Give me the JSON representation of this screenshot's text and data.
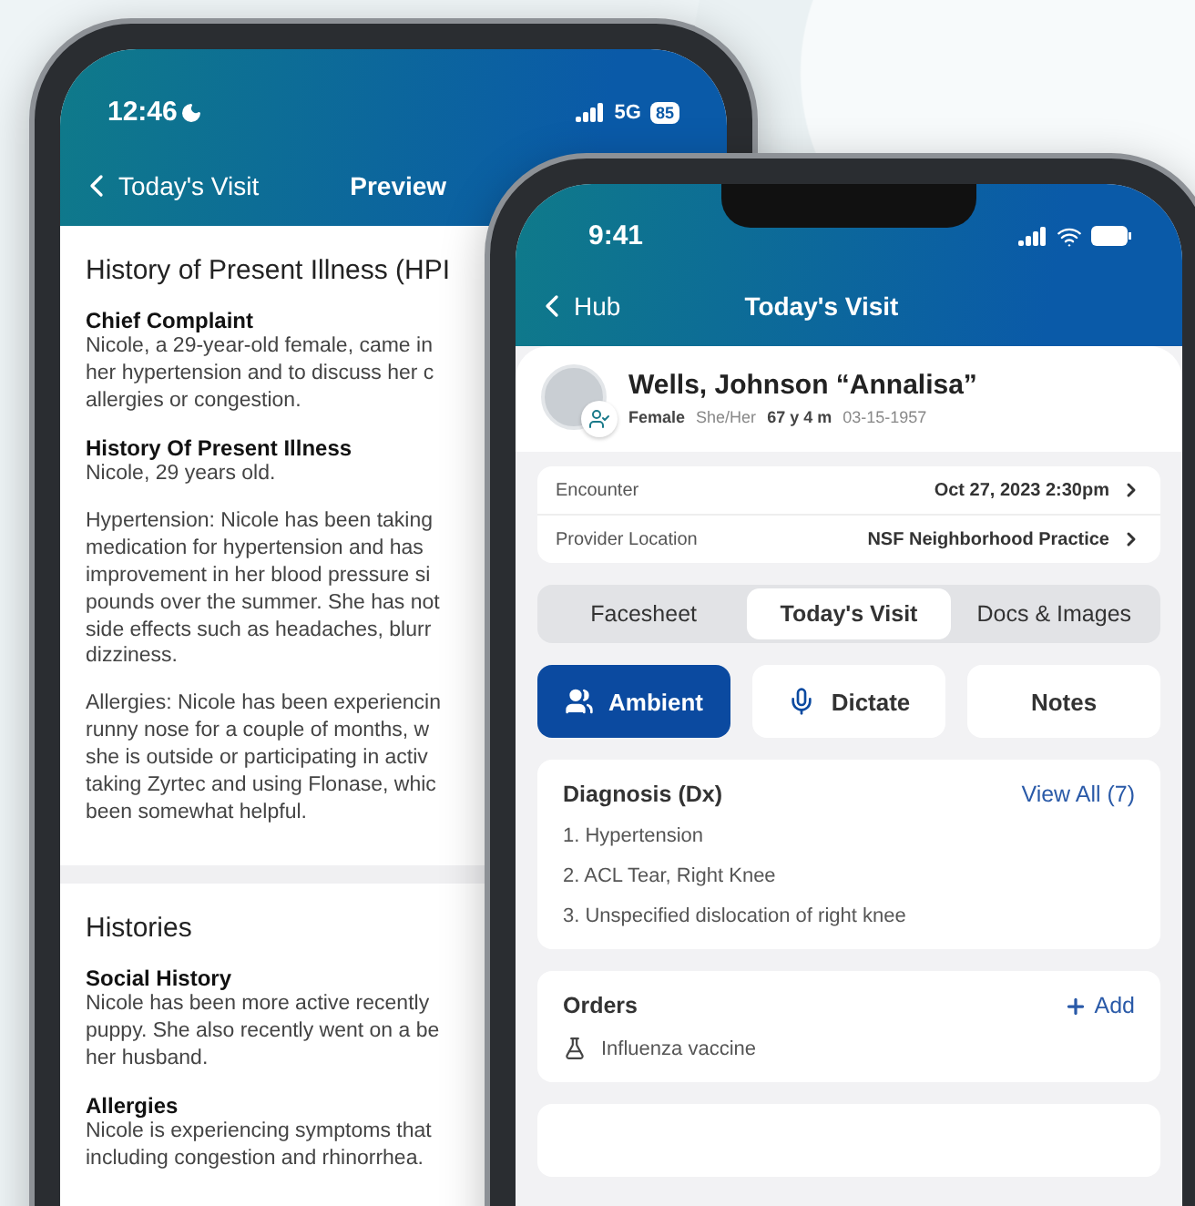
{
  "back_phone": {
    "status_time": "12:46",
    "network": "5G",
    "battery": "85",
    "nav_back": "Today's Visit",
    "nav_title": "Preview",
    "sections": [
      {
        "title": "History of Present Illness (HPI",
        "items": [
          {
            "heading": "Chief Complaint",
            "paragraphs": [
              [
                "Nicole, a 29-year-old female, came in",
                "her hypertension and to discuss her c",
                "allergies or congestion."
              ]
            ]
          },
          {
            "heading": "History Of Present Illness",
            "paragraphs": [
              [
                "Nicole, 29 years old."
              ],
              [
                "Hypertension: Nicole has been taking",
                "medication for hypertension and has",
                "improvement in her blood pressure si",
                "pounds over the summer. She has not",
                "side effects such as headaches, blurr",
                "dizziness."
              ],
              [
                "Allergies: Nicole has been experiencin",
                "runny nose for a couple of months, w",
                "she is outside or participating in activ",
                "taking Zyrtec and using Flonase, whic",
                "been somewhat helpful."
              ]
            ]
          }
        ]
      },
      {
        "title": "Histories",
        "items": [
          {
            "heading": "Social History",
            "paragraphs": [
              [
                "Nicole has been more active recently",
                "puppy. She also recently went on a be",
                "her husband."
              ]
            ]
          },
          {
            "heading": "Allergies",
            "paragraphs": [
              [
                "Nicole is experiencing symptoms that",
                "including congestion and rhinorrhea."
              ]
            ]
          }
        ]
      }
    ]
  },
  "front_phone": {
    "status_time": "9:41",
    "nav_back": "Hub",
    "nav_title": "Today's Visit",
    "patient": {
      "name": "Wells, Johnson “Annalisa”",
      "sex": "Female",
      "pronouns": "She/Her",
      "age": "67 y 4 m",
      "dob": "03-15-1957"
    },
    "details": [
      {
        "label": "Encounter",
        "value": "Oct 27, 2023 2:30pm"
      },
      {
        "label": "Provider Location",
        "value": "NSF Neighborhood Practice"
      }
    ],
    "tabs": [
      {
        "label": "Facesheet",
        "selected": false
      },
      {
        "label": "Today's Visit",
        "selected": true
      },
      {
        "label": "Docs & Images",
        "selected": false
      }
    ],
    "actions": [
      {
        "label": "Ambient",
        "selected": true
      },
      {
        "label": "Dictate",
        "selected": false
      },
      {
        "label": "Notes",
        "selected": false
      }
    ],
    "diagnosis": {
      "title": "Diagnosis (Dx)",
      "link": "View All (7)",
      "items": [
        "1. Hypertension",
        "2. ACL Tear, Right Knee",
        "3. Unspecified dislocation of right knee"
      ]
    },
    "orders": {
      "title": "Orders",
      "action": "Add",
      "items": [
        "Influenza vaccine"
      ]
    }
  }
}
